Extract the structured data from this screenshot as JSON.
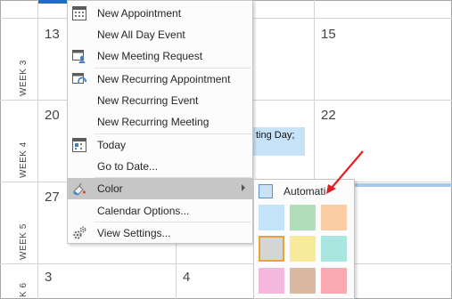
{
  "calendar": {
    "weeks": [
      {
        "label": "WEEK 3",
        "days": [
          "13",
          "15"
        ]
      },
      {
        "label": "WEEK 4",
        "days": [
          "20",
          "22"
        ]
      },
      {
        "label": "WEEK 5",
        "days": [
          "27"
        ]
      },
      {
        "label": "K 6",
        "days": [
          "3",
          "4"
        ]
      }
    ],
    "event_text": "ting Day;"
  },
  "context_menu": {
    "items": [
      {
        "label": "New Appointment",
        "icon": "calendar-icon"
      },
      {
        "label": "New All Day Event",
        "icon": ""
      },
      {
        "label": "New Meeting Request",
        "icon": "meeting-request-icon"
      },
      {
        "label": "New Recurring Appointment",
        "icon": "recurring-appointment-icon"
      },
      {
        "label": "New Recurring Event",
        "icon": ""
      },
      {
        "label": "New Recurring Meeting",
        "icon": ""
      },
      {
        "label": "Today",
        "icon": "today-icon"
      },
      {
        "label": "Go to Date...",
        "icon": ""
      },
      {
        "label": "Color",
        "icon": "color-palette-icon"
      },
      {
        "label": "Calendar Options...",
        "icon": ""
      },
      {
        "label": "View Settings...",
        "icon": "view-settings-icon"
      }
    ],
    "highlighted": "Color"
  },
  "color_submenu": {
    "automatic_label": "Automati",
    "swatches": [
      "#c3e4f8",
      "#b0dfb9",
      "#fccca5",
      "#d5d5d5",
      "#f7ea9a",
      "#a9e6e0",
      "#f4b8dc",
      "#dbb9a1",
      "#f8a9b2"
    ],
    "selected_index": 3
  },
  "colors": {
    "arrow": "#e02020",
    "today_top_bar": "#1e6fc4",
    "menu_highlight": "#c6c6c6"
  }
}
